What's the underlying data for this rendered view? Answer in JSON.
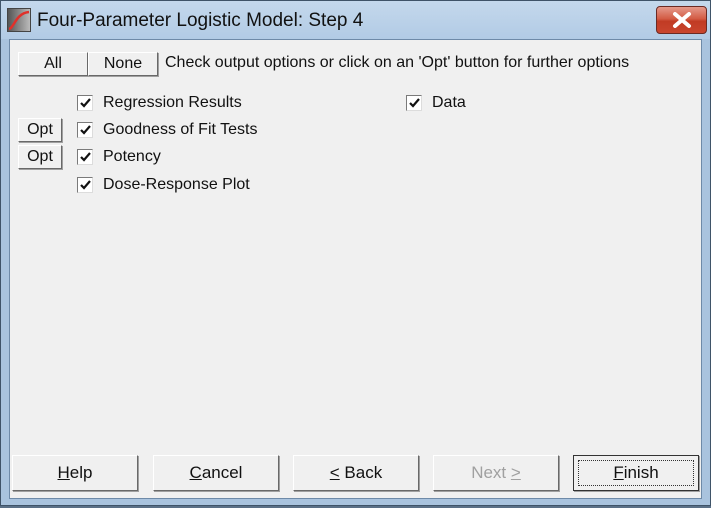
{
  "window": {
    "title": "Four-Parameter Logistic Model: Step 4",
    "app_icon": "logistic-curve-icon",
    "close_icon": "close-x-icon"
  },
  "toolbar": {
    "all_label": "All",
    "none_label": "None",
    "hint": "Check output options or click on an 'Opt' button for further options"
  },
  "options": [
    {
      "label": "Regression Results",
      "checked": true,
      "has_opt": false
    },
    {
      "label": "Goodness of Fit Tests",
      "checked": true,
      "has_opt": true,
      "opt_label": "Opt"
    },
    {
      "label": "Potency",
      "checked": true,
      "has_opt": true,
      "opt_label": "Opt"
    },
    {
      "label": "Dose-Response Plot",
      "checked": true,
      "has_opt": false
    },
    {
      "label": "Data",
      "checked": true,
      "has_opt": false
    }
  ],
  "footer": {
    "help": {
      "prefix": "",
      "mnemonic": "H",
      "rest": "elp",
      "enabled": true
    },
    "cancel": {
      "prefix": "",
      "mnemonic": "C",
      "rest": "ancel",
      "enabled": true
    },
    "back": {
      "prefix": "",
      "mnemonic": "<",
      "rest": " Back",
      "enabled": true
    },
    "next": {
      "prefix": "Next ",
      "mnemonic": ">",
      "rest": "",
      "enabled": false
    },
    "finish": {
      "prefix": "",
      "mnemonic": "F",
      "rest": "inish",
      "enabled": true,
      "default": true
    }
  }
}
